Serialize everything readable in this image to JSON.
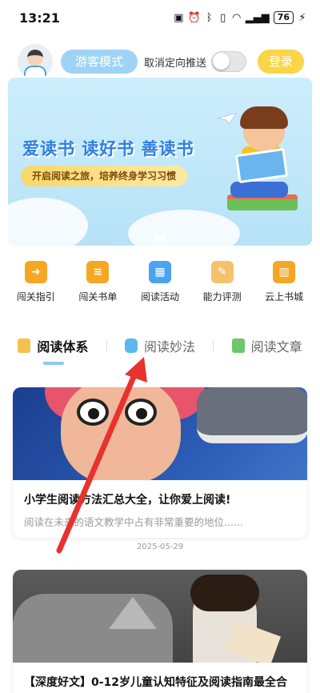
{
  "status_bar": {
    "time": "13:21",
    "icons": [
      "nfc-icon",
      "alarm-icon",
      "bluetooth-icon",
      "vibrate-icon",
      "wifi-icon",
      "signal-icon"
    ],
    "battery": "76"
  },
  "header": {
    "guest_mode_label": "游客模式",
    "push_toggle_label": "取消定向推送",
    "push_toggle_on": false,
    "login_label": "登录"
  },
  "banner": {
    "title": "爱读书 读好书 善读书",
    "subtitle": "开启阅读之旅，培养终身学习习惯"
  },
  "quick_nav": {
    "items": [
      {
        "label": "闯关指引",
        "icon": "arrow-right-doc-icon",
        "color": "#f5a623"
      },
      {
        "label": "闯关书单",
        "icon": "book-list-icon",
        "color": "#f5a623"
      },
      {
        "label": "阅读活动",
        "icon": "calendar-icon",
        "color": "#4aa3f0"
      },
      {
        "label": "能力评测",
        "icon": "paper-scroll-icon",
        "color": "#f5c26b"
      },
      {
        "label": "云上书城",
        "icon": "bookshelf-icon",
        "color": "#f5a623"
      }
    ]
  },
  "tabs": {
    "items": [
      {
        "label": "阅读体系",
        "icon": "reading-system-icon",
        "active": true
      },
      {
        "label": "阅读妙法",
        "icon": "tv-icon",
        "active": false
      },
      {
        "label": "阅读文章",
        "icon": "article-icon",
        "active": false
      }
    ]
  },
  "articles": [
    {
      "title": "小学生阅读方法汇总大全，让你爱上阅读!",
      "desc": "阅读在未来的语文教学中占有非常重要的地位......",
      "date": "2025-05-29"
    },
    {
      "title": "【深度好文】0-12岁儿童认知特征及阅读指南最全合"
    }
  ],
  "colors": {
    "accent_blue": "#9fd3f5",
    "login_yellow": "#f9d548",
    "annotation_red": "#e8322e"
  }
}
